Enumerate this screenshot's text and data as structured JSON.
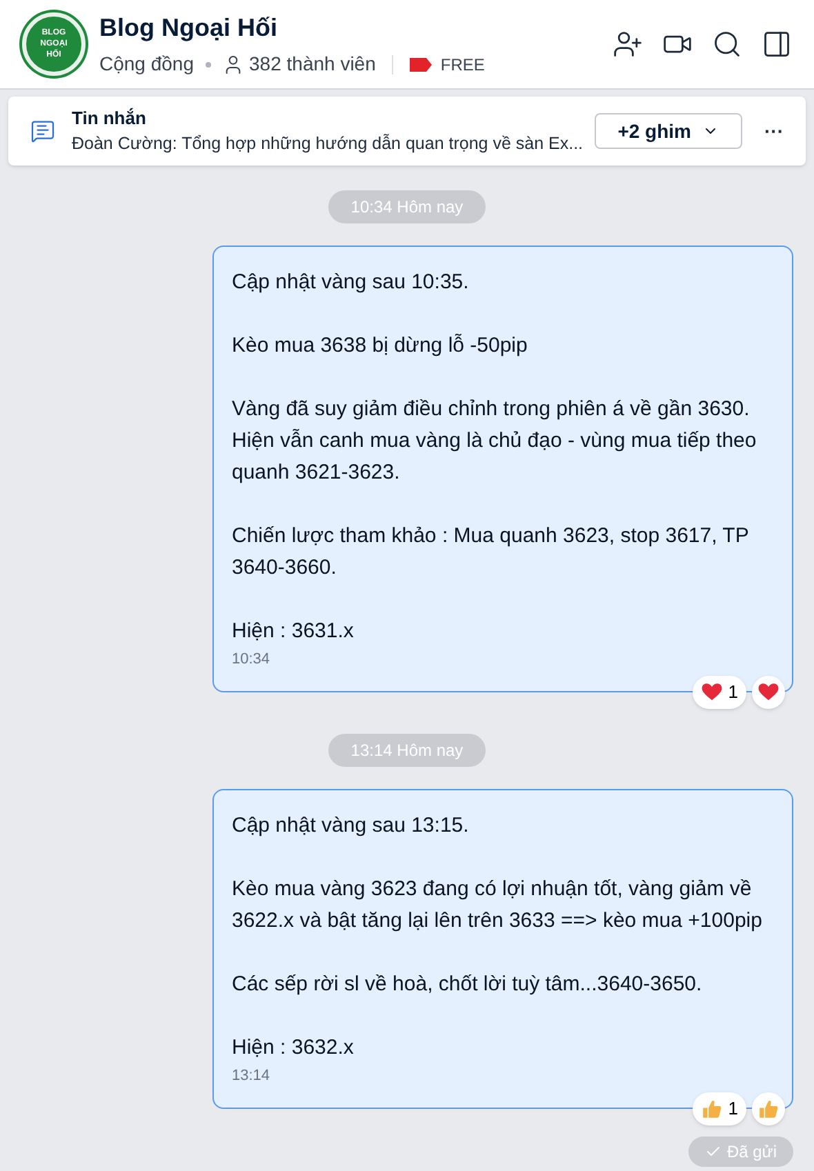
{
  "header": {
    "avatar_text": "BLOG NGOẠI HỐI",
    "title": "Blog Ngoại Hối",
    "type": "Cộng đồng",
    "members": "382 thành viên",
    "tag": "FREE"
  },
  "pinned": {
    "title": "Tin nhắn",
    "preview": "Đoàn Cường: Tổng hợp những hướng dẫn quan trọng về sàn Ex...",
    "pins_button": "+2 ghim",
    "more": "···"
  },
  "messages": [
    {
      "divider": "10:34 Hôm nay",
      "paragraphs": [
        "Cập nhật vàng sau 10:35.",
        "Kèo mua 3638 bị dừng lỗ -50pip",
        "Vàng đã suy giảm điều chỉnh trong phiên á về gần 3630. Hiện vẫn canh mua vàng là chủ đạo - vùng mua tiếp theo quanh 3621-3623.",
        "Chiến lược tham khảo : Mua quanh 3623, stop 3617, TP 3640-3660.",
        "Hiện : 3631.x"
      ],
      "time": "10:34",
      "reaction": {
        "kind": "heart",
        "count": "1"
      }
    },
    {
      "divider": "13:14 Hôm nay",
      "paragraphs": [
        "Cập nhật vàng sau 13:15.",
        "Kèo mua vàng 3623 đang có lợi nhuận tốt, vàng giảm về 3622.x và bật tăng lại lên trên 3633 ==> kèo mua +100pip",
        "Các sếp rời sl về hoà, chốt lời tuỳ tâm...3640-3650.",
        "Hiện : 3632.x"
      ],
      "time": "13:14",
      "reaction": {
        "kind": "thumbs",
        "count": "1"
      }
    }
  ],
  "status": "Đã gửi"
}
